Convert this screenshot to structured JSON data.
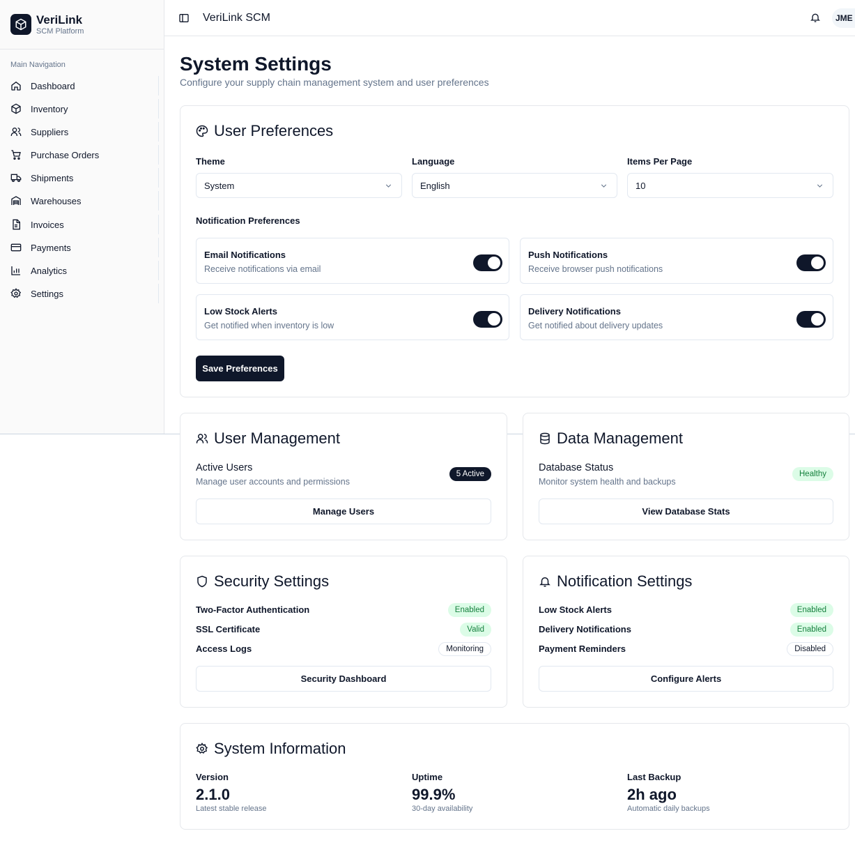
{
  "brand": {
    "name": "VeriLink",
    "subtitle": "SCM Platform"
  },
  "sidebar": {
    "section_label": "Main Navigation",
    "items": [
      {
        "label": "Dashboard",
        "icon": "home-icon"
      },
      {
        "label": "Inventory",
        "icon": "package-icon"
      },
      {
        "label": "Suppliers",
        "icon": "users-icon"
      },
      {
        "label": "Purchase Orders",
        "icon": "cart-icon"
      },
      {
        "label": "Shipments",
        "icon": "truck-icon"
      },
      {
        "label": "Warehouses",
        "icon": "warehouse-icon"
      },
      {
        "label": "Invoices",
        "icon": "file-icon"
      },
      {
        "label": "Payments",
        "icon": "credit-card-icon"
      },
      {
        "label": "Analytics",
        "icon": "chart-icon"
      },
      {
        "label": "Settings",
        "icon": "gear-icon"
      }
    ]
  },
  "header": {
    "title": "VeriLink SCM",
    "avatar": "JME"
  },
  "page": {
    "title": "System Settings",
    "subtitle": "Configure your supply chain management system and user preferences"
  },
  "user_preferences": {
    "title": "User Preferences",
    "theme": {
      "label": "Theme",
      "value": "System"
    },
    "language": {
      "label": "Language",
      "value": "English"
    },
    "items_per_page": {
      "label": "Items Per Page",
      "value": "10"
    },
    "notif_label": "Notification Preferences",
    "toggles": [
      {
        "title": "Email Notifications",
        "desc": "Receive notifications via email",
        "on": true
      },
      {
        "title": "Push Notifications",
        "desc": "Receive browser push notifications",
        "on": true
      },
      {
        "title": "Low Stock Alerts",
        "desc": "Get notified when inventory is low",
        "on": true
      },
      {
        "title": "Delivery Notifications",
        "desc": "Get notified about delivery updates",
        "on": true
      }
    ],
    "save_label": "Save Preferences"
  },
  "user_management": {
    "title": "User Management",
    "row_title": "Active Users",
    "row_desc": "Manage user accounts and permissions",
    "badge": "5 Active",
    "button": "Manage Users"
  },
  "data_management": {
    "title": "Data Management",
    "row_title": "Database Status",
    "row_desc": "Monitor system health and backups",
    "badge": "Healthy",
    "button": "View Database Stats"
  },
  "security": {
    "title": "Security Settings",
    "rows": [
      {
        "label": "Two-Factor Authentication",
        "status": "Enabled"
      },
      {
        "label": "SSL Certificate",
        "status": "Valid"
      },
      {
        "label": "Access Logs",
        "status": "Monitoring"
      }
    ],
    "button": "Security Dashboard"
  },
  "notification_settings": {
    "title": "Notification Settings",
    "rows": [
      {
        "label": "Low Stock Alerts",
        "status": "Enabled"
      },
      {
        "label": "Delivery Notifications",
        "status": "Enabled"
      },
      {
        "label": "Payment Reminders",
        "status": "Disabled"
      }
    ],
    "button": "Configure Alerts"
  },
  "system_info": {
    "title": "System Information",
    "items": [
      {
        "label": "Version",
        "value": "2.1.0",
        "desc": "Latest stable release"
      },
      {
        "label": "Uptime",
        "value": "99.9%",
        "desc": "30-day availability"
      },
      {
        "label": "Last Backup",
        "value": "2h ago",
        "desc": "Automatic daily backups"
      }
    ]
  },
  "colors": {
    "primary": "#0f172a",
    "muted": "#64748b",
    "success_bg": "#dcfce7",
    "success_text": "#15803d",
    "border": "#e5e7eb"
  }
}
